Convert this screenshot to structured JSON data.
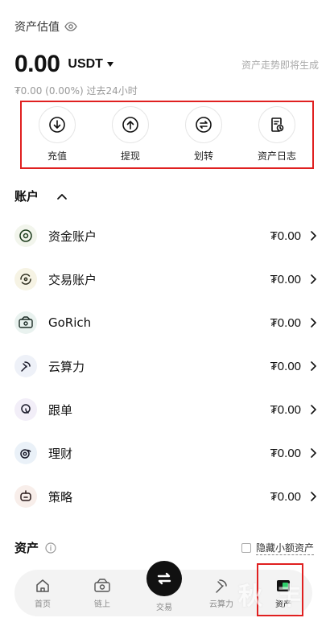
{
  "header": {
    "estimate_label": "资产估值",
    "balance": "0.00",
    "currency": "USDT",
    "trend_text": "资产走势即将生成",
    "change_text": "₮0.00 (0.00%) 过去24小时"
  },
  "actions": [
    {
      "label": "充值",
      "icon": "download-icon"
    },
    {
      "label": "提现",
      "icon": "upload-icon"
    },
    {
      "label": "划转",
      "icon": "transfer-icon"
    },
    {
      "label": "资产日志",
      "icon": "log-icon"
    }
  ],
  "accounts_header": "账户",
  "accounts": [
    {
      "name": "资金账户",
      "value": "₮0.00",
      "icon": "funding-icon"
    },
    {
      "name": "交易账户",
      "value": "₮0.00",
      "icon": "trading-icon"
    },
    {
      "name": "GoRich",
      "value": "₮0.00",
      "icon": "gorich-icon"
    },
    {
      "name": "云算力",
      "value": "₮0.00",
      "icon": "cloud-mining-icon"
    },
    {
      "name": "跟单",
      "value": "₮0.00",
      "icon": "copy-trading-icon"
    },
    {
      "name": "理财",
      "value": "₮0.00",
      "icon": "earn-icon"
    },
    {
      "name": "策略",
      "value": "₮0.00",
      "icon": "strategy-bot-icon"
    }
  ],
  "assets_section": {
    "title": "资产",
    "hide_small_label": "隐藏小额资产"
  },
  "tabbar": {
    "home": "首页",
    "onchain": "链上",
    "trade": "交易",
    "cloud": "云算力",
    "assets": "资产"
  },
  "watermark": "秋 丰",
  "colors": {
    "highlight_border": "#e02020",
    "accent_green": "#1a7f3c",
    "text_primary": "#111111",
    "text_secondary": "#999999"
  }
}
